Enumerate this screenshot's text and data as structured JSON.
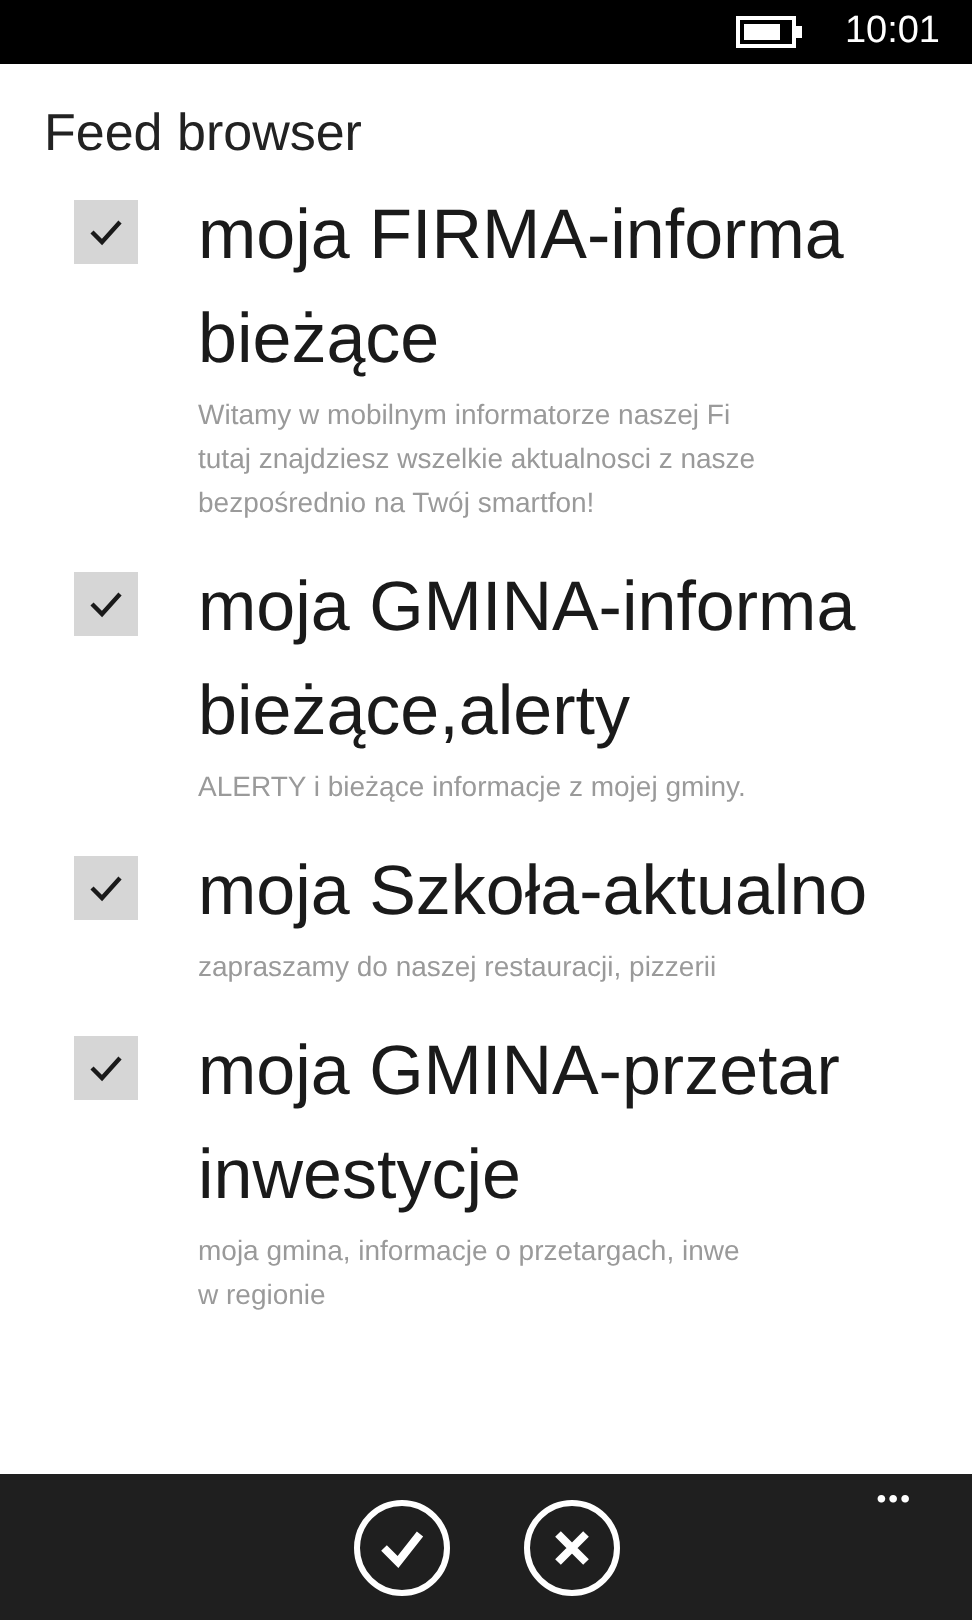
{
  "status_bar": {
    "time": "10:01"
  },
  "page": {
    "title": "Feed browser"
  },
  "feeds": [
    {
      "checked": true,
      "title_lines": [
        "moja FIRMA-informa",
        "bieżące"
      ],
      "description_lines": [
        "Witamy w mobilnym informatorze naszej Fi",
        "tutaj znajdziesz wszelkie aktualnosci z nasze",
        "bezpośrednio na Twój smartfon!"
      ]
    },
    {
      "checked": true,
      "title_lines": [
        "moja GMINA-informa",
        "bieżące,alerty"
      ],
      "description_lines": [
        "ALERTY i bieżące informacje z mojej gminy."
      ]
    },
    {
      "checked": true,
      "title_lines": [
        "moja Szkoła-aktualno"
      ],
      "description_lines": [
        "zapraszamy do naszej restauracji, pizzerii"
      ]
    },
    {
      "checked": true,
      "title_lines": [
        "moja GMINA-przetar",
        "inwestycje"
      ],
      "description_lines": [
        "moja gmina, informacje o przetargach, inwe",
        "w regionie"
      ]
    }
  ],
  "app_bar": {
    "buttons": [
      {
        "kind": "accept"
      },
      {
        "kind": "cancel"
      }
    ],
    "more": "•••"
  }
}
